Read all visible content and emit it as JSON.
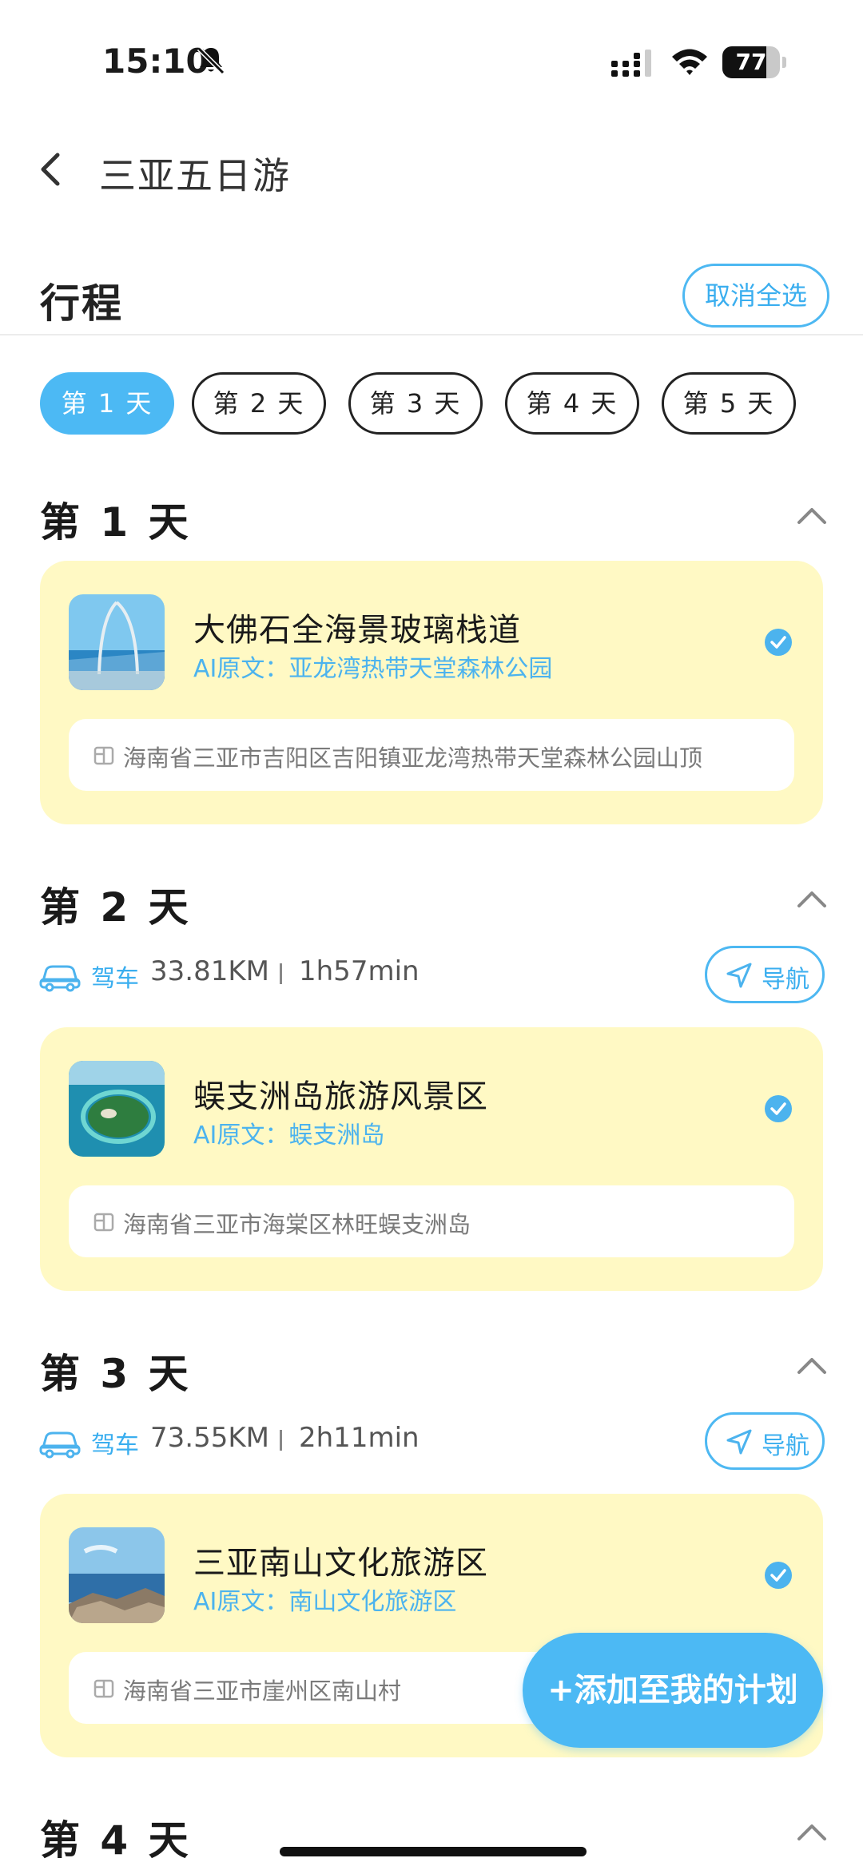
{
  "status_bar": {
    "time": "15:10",
    "battery": "77",
    "battery_level": 0.77
  },
  "header": {
    "title": "三亚五日游"
  },
  "section": {
    "title": "行程",
    "deselect_label": "取消全选"
  },
  "day_tabs": [
    {
      "label": "第 1 天",
      "active": true
    },
    {
      "label": "第 2 天",
      "active": false
    },
    {
      "label": "第 3 天",
      "active": false
    },
    {
      "label": "第 4 天",
      "active": false
    },
    {
      "label": "第 5 天",
      "active": false
    }
  ],
  "days": [
    {
      "title": "第 1 天",
      "spot": {
        "name": "大佛石全海景玻璃栈道",
        "ai_original": "AI原文：亚龙湾热带天堂森林公园",
        "address": "海南省三亚市吉阳区吉阳镇亚龙湾热带天堂森林公园山顶"
      }
    },
    {
      "title": "第 2 天",
      "drive": {
        "mode": "驾车",
        "distance": "33.81KM",
        "duration": "1h57min",
        "nav_label": "导航"
      },
      "spot": {
        "name": "蜈支洲岛旅游风景区",
        "ai_original": "AI原文：蜈支洲岛",
        "address": "海南省三亚市海棠区林旺蜈支洲岛"
      }
    },
    {
      "title": "第 3 天",
      "drive": {
        "mode": "驾车",
        "distance": "73.55KM",
        "duration": "2h11min",
        "nav_label": "导航"
      },
      "spot": {
        "name": "三亚南山文化旅游区",
        "ai_original": "AI原文：南山文化旅游区",
        "address": "海南省三亚市崖州区南山村"
      }
    },
    {
      "title": "第 4 天"
    }
  ],
  "actions": {
    "add_to_plan": "+添加至我的计划"
  },
  "colors": {
    "accent": "#4cb9f4",
    "card": "#fff9c4"
  }
}
